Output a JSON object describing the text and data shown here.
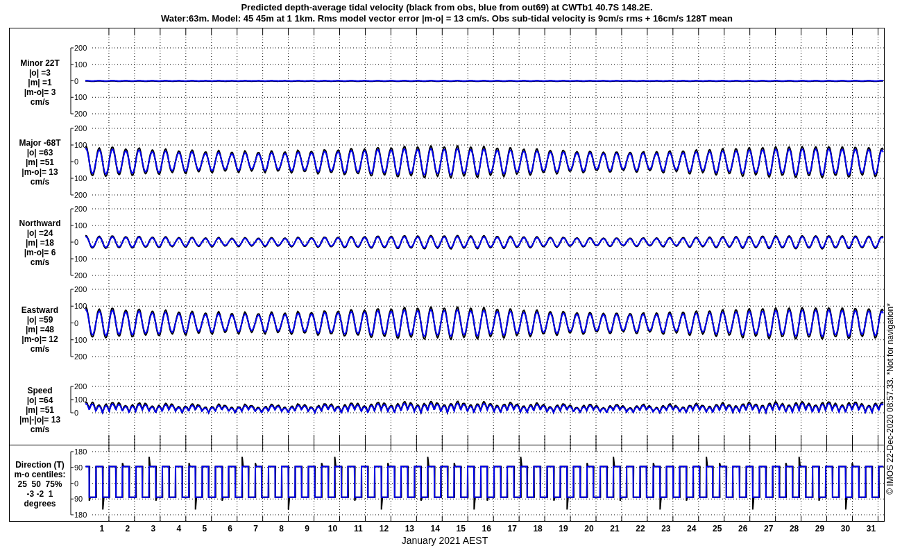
{
  "title": [
    "Predicted depth-average tidal velocity (black from obs, blue from out69) at CWTb1 40.7S 148.2E.",
    "Water:63m. Model: 45 45m at 1 1km. Rms model vector error |m-o| = 13 cm/s. Obs sub-tidal velocity is 9cm/s rms + 16cm/s 128T mean"
  ],
  "panels": [
    {
      "kind": "flat",
      "label": [
        "Minor 22T",
        "|o| =3",
        "|m| =1",
        "|m-o|= 3",
        "cm/s"
      ],
      "yticks": [
        "200",
        "100",
        "0",
        "100",
        "200"
      ]
    },
    {
      "kind": "wave",
      "label": [
        "Major -68T",
        "|o| =63",
        "|m| =51",
        "|m-o|= 13",
        "cm/s"
      ],
      "yticks": [
        "200",
        "100",
        "0",
        "100",
        "200"
      ]
    },
    {
      "kind": "wave",
      "label": [
        "Northward",
        "|o| =24",
        "|m| =18",
        "|m-o|= 6",
        "cm/s"
      ],
      "yticks": [
        "200",
        "100",
        "0",
        "100",
        "200"
      ]
    },
    {
      "kind": "wave",
      "label": [
        "Eastward",
        "|o| =59",
        "|m| =48",
        "|m-o|= 12",
        "cm/s"
      ],
      "yticks": [
        "200",
        "100",
        "0",
        "100",
        "200"
      ]
    },
    {
      "kind": "speed",
      "label": [
        "Speed",
        "|o| =64",
        "|m| =51",
        "|m|-|o|= 13",
        "cm/s"
      ],
      "yticks": [
        "200",
        "100",
        "0"
      ]
    },
    {
      "kind": "direction",
      "label": [
        "Direction (T)",
        "m-o centiles:",
        "25  50  75%",
        "-3 -2  1",
        "degrees"
      ],
      "yticks": [
        "180",
        "90",
        "0",
        "90",
        "180"
      ]
    }
  ],
  "days": [
    "1",
    "2",
    "3",
    "4",
    "5",
    "6",
    "7",
    "8",
    "9",
    "10",
    "11",
    "12",
    "13",
    "14",
    "15",
    "16",
    "17",
    "18",
    "19",
    "20",
    "21",
    "22",
    "23",
    "24",
    "25",
    "26",
    "27",
    "28",
    "29",
    "30",
    "31"
  ],
  "xlabel": "January 2021 AEST",
  "credit": "© IMOS 22-Dec-2020 08:57.33. *Not for navigation*"
}
